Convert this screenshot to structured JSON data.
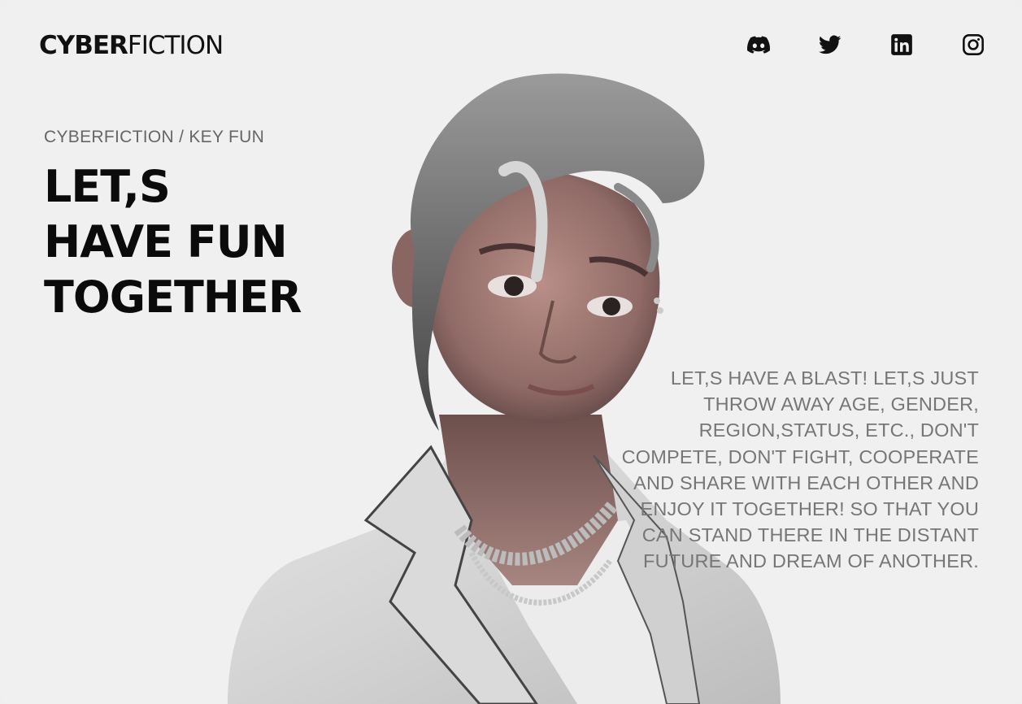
{
  "brand": {
    "bold": "CYBER",
    "light": "FICTION"
  },
  "social": [
    {
      "icon": "discord-icon"
    },
    {
      "icon": "twitter-icon"
    },
    {
      "icon": "linkedin-icon"
    },
    {
      "icon": "instagram-icon"
    }
  ],
  "hero": {
    "breadcrumb": "CYBERFICTION / KEY FUN",
    "headline": [
      "LET,S",
      "HAVE FUN",
      "TOGETHER"
    ],
    "body": "LET,S HAVE A BLAST! LET,S JUST THROW AWAY AGE, GENDER, REGION,STATUS, ETC., DON'T COMPETE, DON'T FIGHT, COOPERATE AND SHARE WITH EACH OTHER AND ENJOY IT TOGETHER! SO THAT YOU CAN STAND THERE IN THE DISTANT FUTURE AND DREAM OF ANOTHER."
  },
  "colors": {
    "background": "#f0f0f0",
    "text": "#0b0b0b",
    "muted": "#767676"
  }
}
